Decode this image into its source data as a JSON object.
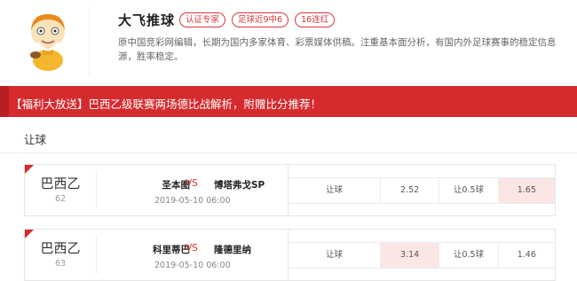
{
  "expert": {
    "name": "大飞推球",
    "tags": [
      "认证专家",
      "足球近9中6",
      "16连红"
    ],
    "bio": "原中国竞彩网编辑，长期为国内多家体育、彩票媒体供稿。注重基本面分析，有国内外足球赛事的稳定信息源，胜率稳定。"
  },
  "banner": {
    "text": "【福利大放送】巴西乙级联赛两场德比战解析，附赠比分推荐！"
  },
  "section": {
    "title": "让球"
  },
  "colors": {
    "accent": "#d52b2e",
    "highlight": "#fbe6e6"
  },
  "matches": [
    {
      "league": "巴西乙",
      "number": "62",
      "home": "圣本图",
      "vs": "VS",
      "away": "博塔弗戈SP",
      "time": "2019-05-10 06:00",
      "odds": {
        "label1": "让球",
        "value1": "2.52",
        "label2": "让0.5球",
        "value2": "1.65"
      },
      "selected": "value2"
    },
    {
      "league": "巴西乙",
      "number": "63",
      "home": "科里蒂巴",
      "vs": "VS",
      "away": "隆德里纳",
      "time": "2019-05-10 06:00",
      "odds": {
        "label1": "让球",
        "value1": "3.14",
        "label2": "让0.5球",
        "value2": "1.46"
      },
      "selected": "value1"
    }
  ]
}
